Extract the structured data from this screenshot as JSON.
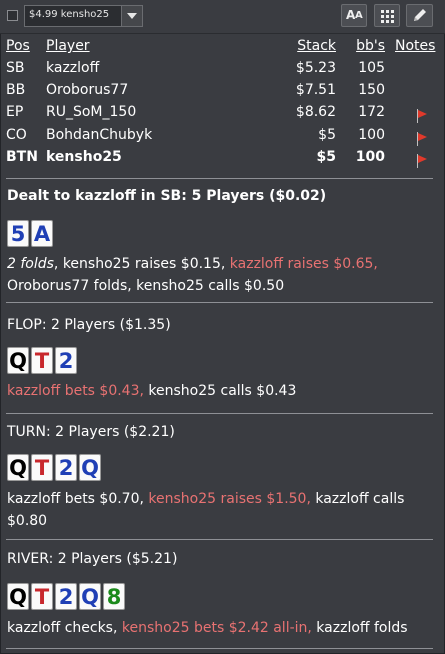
{
  "toolbar": {
    "table_select_value": "$4.99 kensho25",
    "aa_label_big": "A",
    "aa_label_small": "A"
  },
  "players_table": {
    "headers": {
      "pos": "Pos",
      "player": "Player",
      "stack": "Stack",
      "bbs": "bb's",
      "notes": "Notes"
    },
    "rows": [
      {
        "pos": "SB",
        "player": "kazzloff",
        "stack": "$5.23",
        "bbs": "105",
        "flag": false,
        "bold": false
      },
      {
        "pos": "BB",
        "player": "Oroborus77",
        "stack": "$7.51",
        "bbs": "150",
        "flag": false,
        "bold": false
      },
      {
        "pos": "EP",
        "player": "RU_SoM_150",
        "stack": "$8.62",
        "bbs": "172",
        "flag": true,
        "bold": false
      },
      {
        "pos": "CO",
        "player": "BohdanChubyk",
        "stack": "$5",
        "bbs": "100",
        "flag": true,
        "bold": false
      },
      {
        "pos": "BTN",
        "player": "kensho25",
        "stack": "$5",
        "bbs": "100",
        "flag": true,
        "bold": true
      }
    ],
    "flag_color": "#e0392b"
  },
  "preflop": {
    "title": "Dealt to kazzloff in SB: 5 Players ($0.02)",
    "cards": [
      {
        "rank": "5",
        "suit": "d"
      },
      {
        "rank": "A",
        "suit": "d"
      }
    ],
    "line1_folds": "2 folds",
    "line1_a": ", kensho25 raises $0.15, ",
    "line1_hero": "kazzloff raises $0.65,",
    "line2": "Oroborus77 folds, kensho25 calls $0.50"
  },
  "flop": {
    "title": "FLOP: 2 Players ($1.35)",
    "cards": [
      {
        "rank": "Q",
        "suit": "s"
      },
      {
        "rank": "T",
        "suit": "h"
      },
      {
        "rank": "2",
        "suit": "d"
      }
    ],
    "hero": "kazzloff bets $0.43,",
    "rest": " kensho25 calls $0.43"
  },
  "turn": {
    "title": "TURN: 2 Players ($2.21)",
    "cards": [
      {
        "rank": "Q",
        "suit": "s"
      },
      {
        "rank": "T",
        "suit": "h"
      },
      {
        "rank": "2",
        "suit": "d"
      },
      {
        "rank": "Q",
        "suit": "d"
      }
    ],
    "a": "kazzloff bets $0.70, ",
    "hero": "kensho25 raises $1.50,",
    "b": " kazzloff calls",
    "line2": "$0.80"
  },
  "river": {
    "title": "RIVER: 2 Players ($5.21)",
    "cards": [
      {
        "rank": "Q",
        "suit": "s"
      },
      {
        "rank": "T",
        "suit": "h"
      },
      {
        "rank": "2",
        "suit": "d"
      },
      {
        "rank": "Q",
        "suit": "d"
      },
      {
        "rank": "8",
        "suit": "c"
      }
    ],
    "a": "kazzloff checks, ",
    "hero": "kensho25 bets $2.42 all-in,",
    "b": " kazzloff folds"
  },
  "colors": {
    "background": "#3a3c41",
    "hero_action": "#e87272",
    "spade": "#000000",
    "heart": "#c8282d",
    "diamond": "#1f3fb5",
    "club": "#1b8a1b"
  }
}
